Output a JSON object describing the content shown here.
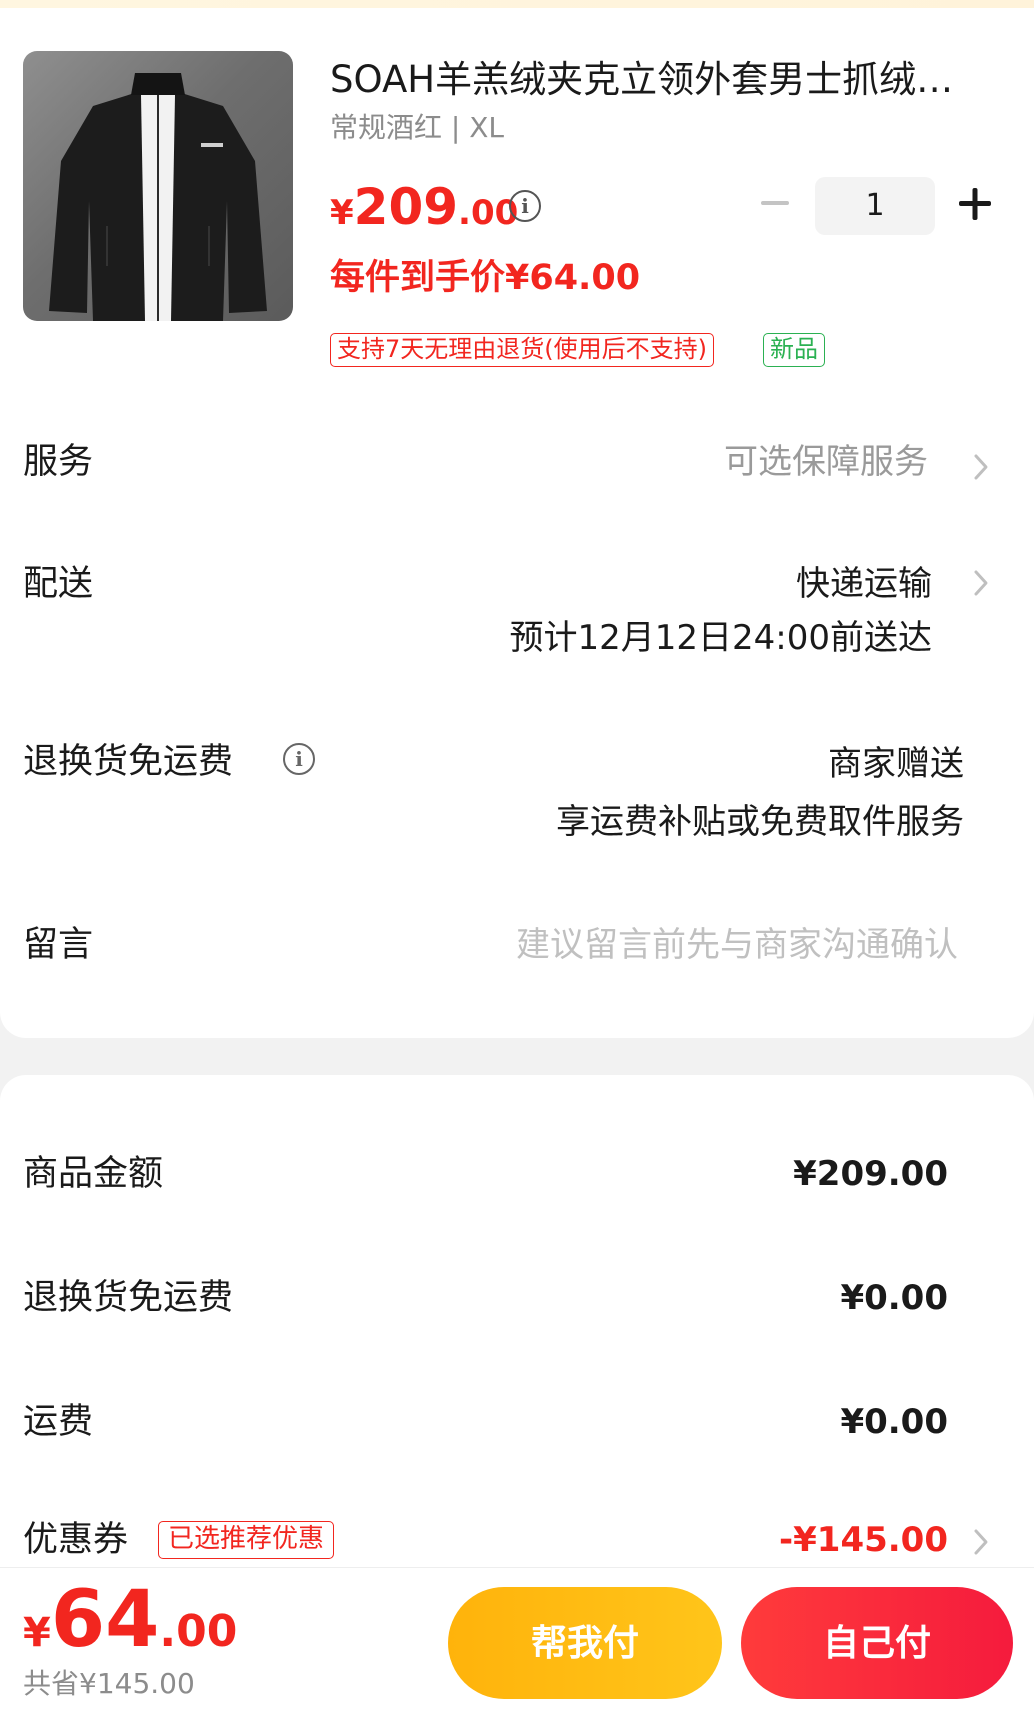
{
  "product": {
    "title": "SOAH羊羔绒夹克立领外套男士抓绒…",
    "spec": "常规酒红 | XL",
    "price_currency": "¥",
    "price_int": "209",
    "price_dec": ".00",
    "quantity": "1",
    "hand_price": "每件到手价¥64.00",
    "tags": {
      "return_policy": "支持7天无理由退货(使用后不支持)",
      "new": "新品"
    }
  },
  "rows": {
    "service": {
      "label": "服务",
      "value": "可选保障服务"
    },
    "delivery": {
      "label": "配送",
      "value": "快递运输",
      "eta": "预计12月12日24:00前送达"
    },
    "return_shipping": {
      "label": "退换货免运费",
      "value": "商家赠送",
      "detail": "享运费补贴或免费取件服务"
    },
    "message": {
      "label": "留言",
      "placeholder": "建议留言前先与商家沟通确认"
    }
  },
  "summary": {
    "goods_amount": {
      "label": "商品金额",
      "value": "¥209.00"
    },
    "return_shipping": {
      "label": "退换货免运费",
      "value": "¥0.00"
    },
    "shipping": {
      "label": "运费",
      "value": "¥0.00"
    },
    "coupon": {
      "label": "优惠券",
      "tag": "已选推荐优惠",
      "value": "-¥145.00"
    }
  },
  "bottom": {
    "total_currency": "¥",
    "total_int": "64",
    "total_dec": ".00",
    "saved": "共省¥145.00",
    "help_pay": "帮我付",
    "self_pay": "自己付"
  },
  "colors": {
    "accent_red": "#f2261f",
    "new_green": "#2bb152",
    "help_button": "#ffb30b",
    "pay_button": "#ff3b3b"
  },
  "icons": [
    "info-icon",
    "chevron-right-icon",
    "minus-icon",
    "plus-icon"
  ]
}
